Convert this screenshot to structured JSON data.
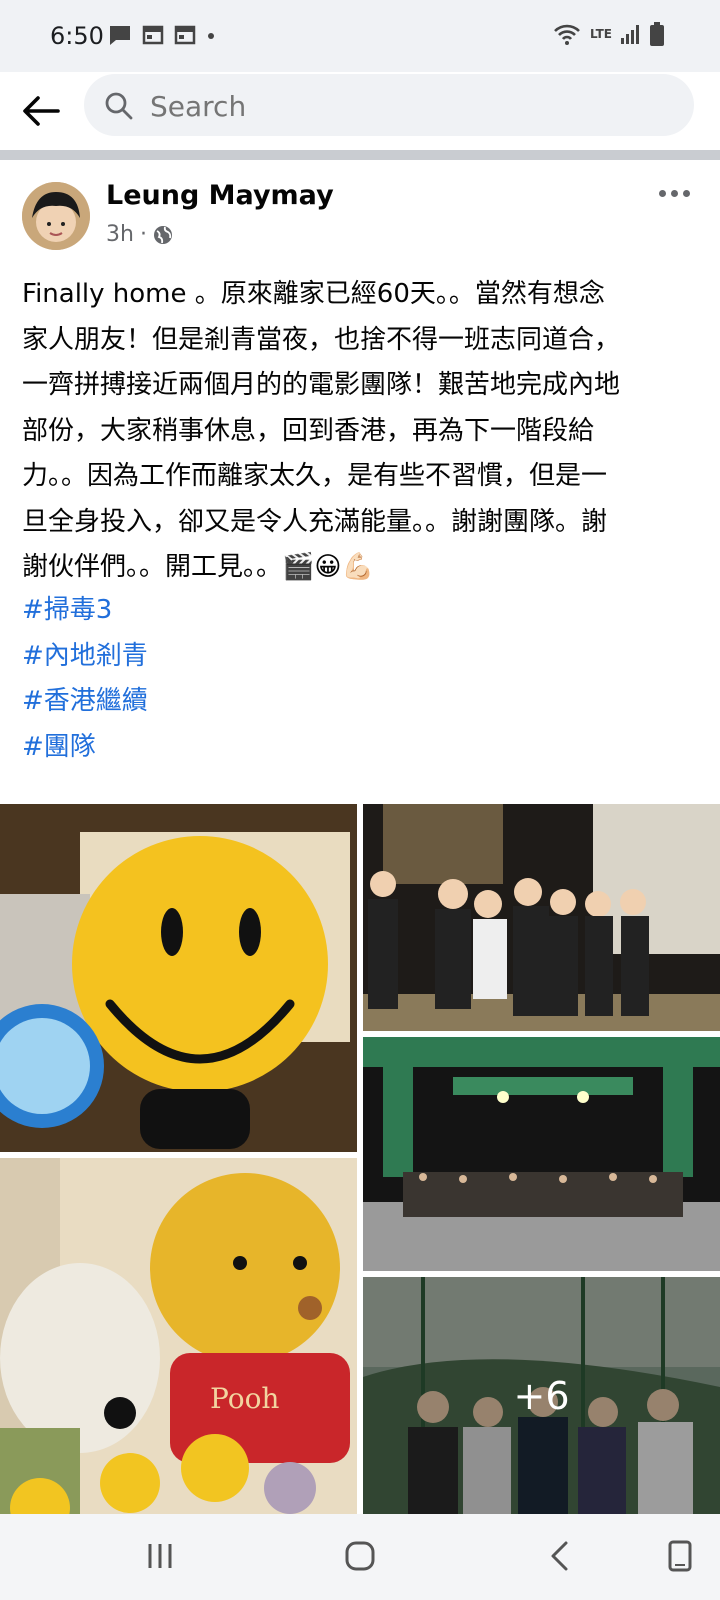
{
  "status_bar": {
    "time": "6:50",
    "network": "LTE"
  },
  "search": {
    "placeholder": "Search"
  },
  "post": {
    "author": "Leung Maymay",
    "time": "3h",
    "privacy_icon": "globe-icon",
    "body_lines": [
      "Finally home 。原來離家已經60天。。當然有想念",
      "家人朋友！但是剎青當夜，也捨不得一班志同道合，",
      "一齊拼搏接近兩個月的的電影團隊！艱苦地完成內地",
      "部份，大家稍事休息，回到香港，再為下一階段給",
      "力。。因為工作而離家太久，是有些不習慣，但是一",
      "旦全身投入，卻又是令人充滿能量。。謝謝團隊。謝",
      "謝伙伴們。。開工見。。🎬😀💪🏻"
    ],
    "hashtags": [
      "#掃毒3",
      "#內地剎青",
      "#香港繼續",
      "#團隊"
    ],
    "photos": {
      "items": [
        {
          "label": "smiley lamp photo",
          "icon": "smiley-lamp-photo",
          "palette": "#f2c12e"
        },
        {
          "label": "group photo at night",
          "icon": "group-night-photo",
          "palette": "#2f2a24"
        },
        {
          "label": "film crew group photo",
          "icon": "crew-photo",
          "palette": "#1f5a3c"
        },
        {
          "label": "plush toys photo",
          "icon": "plush-toys-photo",
          "palette": "#e8b830"
        },
        {
          "label": "outdoor group photo",
          "icon": "outdoor-group-photo",
          "palette": "#4f6a5e"
        }
      ],
      "more_count": "+6"
    }
  },
  "nav": {
    "icons": [
      "recent-apps-icon",
      "home-icon",
      "back-icon",
      "rotate-icon"
    ]
  },
  "colors": {
    "link": "#216fdb",
    "text": "#050505",
    "secondary": "#65676b",
    "bg_gray": "#f0f2f5"
  }
}
